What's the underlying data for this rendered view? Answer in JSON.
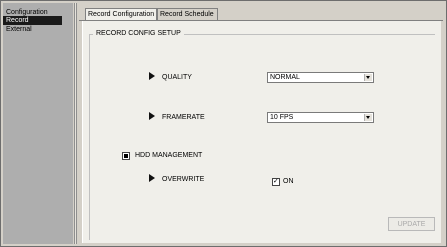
{
  "sidebar": {
    "items": [
      {
        "label": "Configuration"
      },
      {
        "label": "Record"
      },
      {
        "label": "External"
      }
    ]
  },
  "tabs": [
    {
      "label": "Record Configuration"
    },
    {
      "label": "Record Schedule"
    }
  ],
  "setup": {
    "title": "RECORD CONFIG SETUP",
    "quality_label": "QUALITY",
    "quality_value": "NORMAL",
    "framerate_label": "FRAMERATE",
    "framerate_value": "10 FPS",
    "hdd_label": "HDD MANAGEMENT",
    "overwrite_label": "OVERWRITE",
    "overwrite_value": "ON",
    "update_label": "UPDATE"
  }
}
